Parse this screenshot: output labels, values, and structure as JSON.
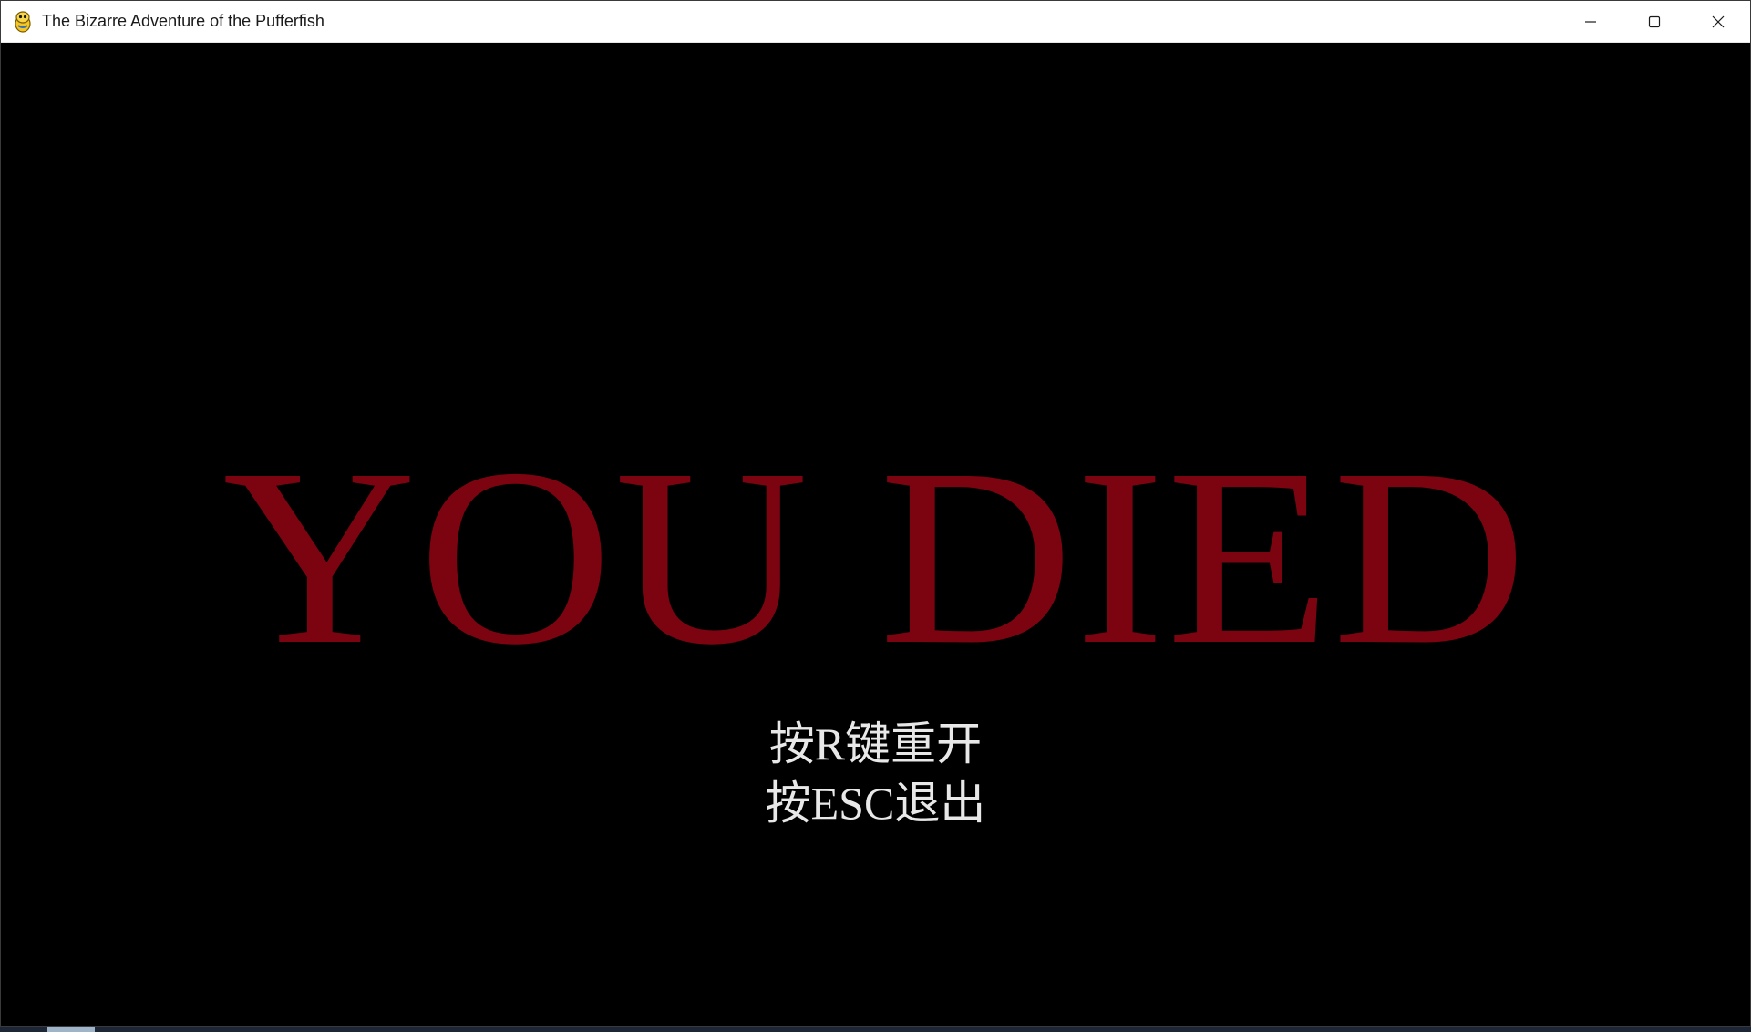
{
  "window": {
    "title": "The Bizarre Adventure of the Pufferfish",
    "app_icon": "pygame-snake-icon",
    "controls": {
      "minimize_icon": "minimize-icon",
      "maximize_icon": "maximize-icon",
      "close_icon": "close-icon"
    }
  },
  "game": {
    "death_message": "YOU DIED",
    "restart_hint": "按R键重开",
    "quit_hint": "按ESC退出",
    "colors": {
      "background": "#000000",
      "death_message": "#7b0410",
      "hint_text": "#e8e8e8"
    }
  }
}
